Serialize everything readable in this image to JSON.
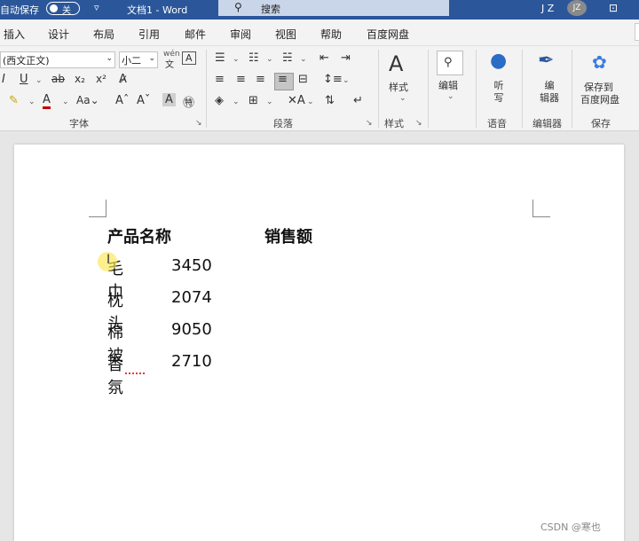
{
  "titlebar": {
    "autosave_label": "自动保存",
    "autosave_state": "关",
    "qat_icon": "customize-qat-icon",
    "doc_title": "文档1  -  Word",
    "search_placeholder": "搜索",
    "user_initials": "J Z",
    "avatar_initials": "JZ",
    "accent": "#2b579a"
  },
  "tabs": [
    "插入",
    "设计",
    "布局",
    "引用",
    "邮件",
    "审阅",
    "视图",
    "帮助",
    "百度网盘"
  ],
  "font_group": {
    "font_name": "(西文正文)",
    "font_size": "小二",
    "wen_label": "wén",
    "wen_char": "文",
    "a_box": "A",
    "label": "字体"
  },
  "paragraph_group": {
    "label": "段落"
  },
  "styles_group": {
    "button": "样式",
    "label": "样式"
  },
  "editing": {
    "button": "编辑"
  },
  "voice_group": {
    "button_line1": "听",
    "button_line2": "写",
    "label": "语音"
  },
  "editor_group": {
    "button_line1": "编",
    "button_line2": "辑器",
    "label": "编辑器"
  },
  "save_group": {
    "button_line1": "保存到",
    "button_line2": "百度网盘",
    "label": "保存"
  },
  "document": {
    "header_product": "产品名称",
    "header_sales": "销售额",
    "rows": [
      {
        "name": "毛巾",
        "value": "3450"
      },
      {
        "name": "枕头",
        "value": "2074"
      },
      {
        "name": "棉被",
        "value": "9050"
      },
      {
        "name": "香氛",
        "value": "2710"
      }
    ]
  },
  "watermark": "CSDN @寒也"
}
